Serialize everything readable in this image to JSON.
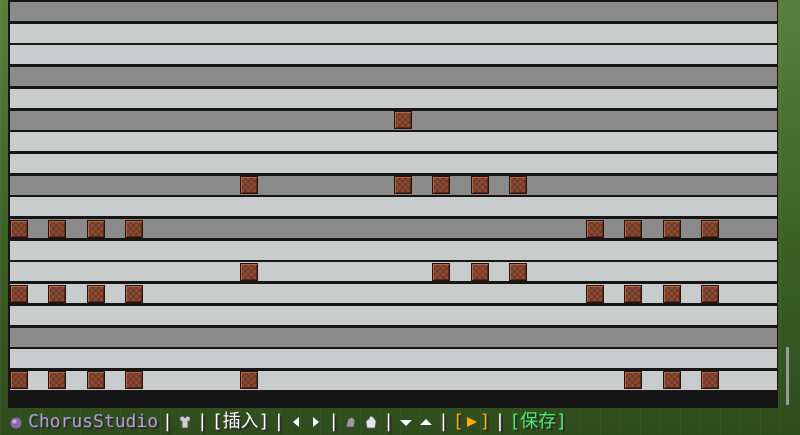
{
  "app": {
    "title": "ChorusStudio"
  },
  "toolbar": {
    "insert_label": "[插入]",
    "save_label": "[保存]",
    "separator": "|"
  },
  "icons": {
    "app": "chorus-fruit-icon",
    "armor": "chestplate-icon",
    "prev": "triangle-left-icon",
    "next": "triangle-right-icon",
    "tool_a": "horse-armor-icon",
    "tool_b": "hand-icon",
    "lower": "triangle-down-icon",
    "raise": "triangle-up-icon",
    "play": "play-icon"
  },
  "colors": {
    "lane_dark": "#8b8b8b",
    "lane_light": "#c8cccc",
    "note": "#8a4a32",
    "title": "#b49bd8",
    "save": "#4ee86a",
    "play": "#ffaa00"
  },
  "lanes": [
    {
      "shade": "dark",
      "notes": []
    },
    {
      "shade": "light",
      "notes": []
    },
    {
      "shade": "light",
      "notes": []
    },
    {
      "shade": "dark",
      "notes": []
    },
    {
      "shade": "light",
      "notes": []
    },
    {
      "shade": "dark",
      "notes": [
        10
      ]
    },
    {
      "shade": "light",
      "notes": []
    },
    {
      "shade": "light",
      "notes": []
    },
    {
      "shade": "dark",
      "notes": [
        6,
        10,
        11,
        12,
        13
      ]
    },
    {
      "shade": "light",
      "notes": []
    },
    {
      "shade": "dark",
      "notes": [
        0,
        1,
        2,
        3,
        15,
        16,
        17,
        18
      ]
    },
    {
      "shade": "light",
      "notes": []
    },
    {
      "shade": "light",
      "notes": [
        6,
        11,
        12,
        13
      ]
    },
    {
      "shade": "light",
      "notes": [
        0,
        1,
        2,
        3,
        15,
        16,
        17,
        18
      ]
    },
    {
      "shade": "light",
      "notes": []
    },
    {
      "shade": "dark",
      "notes": []
    },
    {
      "shade": "light",
      "notes": []
    },
    {
      "shade": "light",
      "notes": [
        0,
        1,
        2,
        3,
        6,
        16,
        17,
        18
      ]
    }
  ]
}
